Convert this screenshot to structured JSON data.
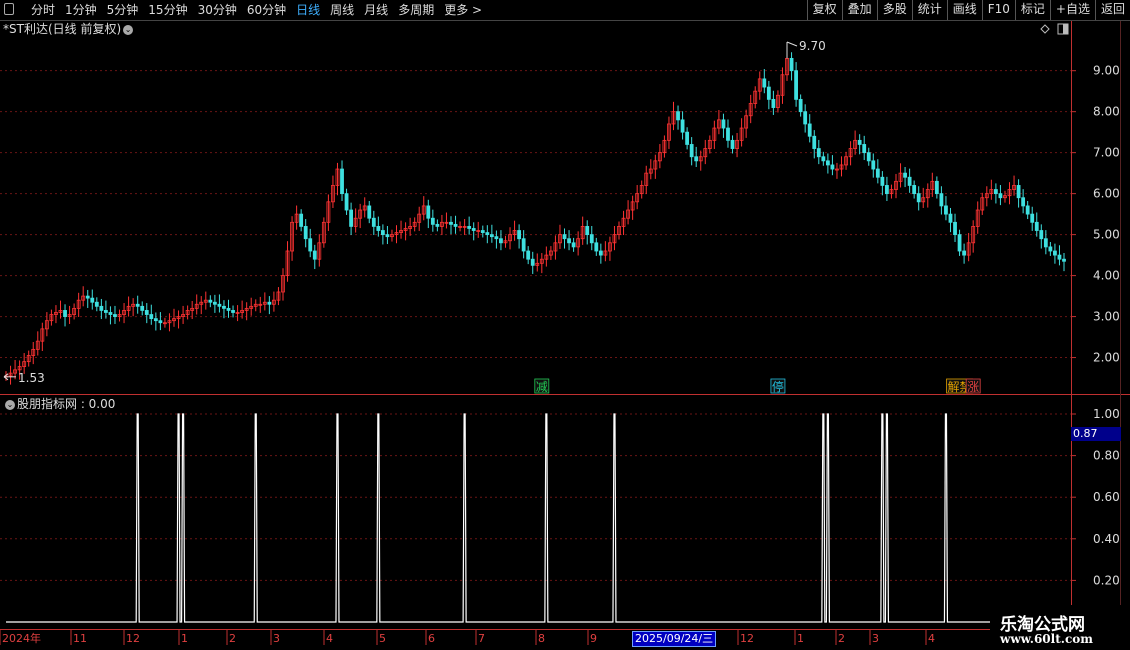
{
  "toolbar": {
    "period_tabs": [
      "分时",
      "1分钟",
      "5分钟",
      "15分钟",
      "30分钟",
      "60分钟",
      "日线",
      "周线",
      "月线",
      "多周期",
      "更多 >"
    ],
    "active_tab": "日线",
    "right_buttons": [
      "复权",
      "叠加",
      "多股",
      "统计",
      "画线",
      "F10",
      "标记",
      "+自选",
      "返回"
    ]
  },
  "main_chart": {
    "title": "*ST利达(日线 前复权)",
    "high_label": "9.70",
    "low_label": "1.53",
    "price_axis": [
      "9.00",
      "8.00",
      "7.00",
      "6.00",
      "5.00",
      "4.00",
      "3.00",
      "2.00"
    ],
    "price_range": [
      1.55,
      9.7
    ],
    "markers": [
      {
        "text": "减",
        "color": "#22cc55",
        "day": 118
      },
      {
        "text": "停",
        "color": "#22c0e0",
        "day": 170
      },
      {
        "text": "解禁",
        "color": "#e0a000",
        "day": 210
      },
      {
        "text": "涨",
        "color": "#e04040",
        "day": 213
      }
    ]
  },
  "indicator": {
    "title": "股朋指标网 : 0.00",
    "axis": [
      "1.00",
      "0.80",
      "0.60",
      "0.40",
      "0.20"
    ],
    "current_value": "0.87",
    "spike_days": [
      29,
      38,
      39,
      55,
      73,
      82,
      101,
      119,
      134,
      180,
      181,
      193,
      194,
      207
    ]
  },
  "date_axis": {
    "labels": [
      "2024年",
      "11",
      "12",
      "1",
      "2",
      "3",
      "4",
      "5",
      "6",
      "7",
      "8",
      "9",
      "12",
      "1",
      "2",
      "3",
      "4"
    ],
    "cursor_label": "2025/09/24/三"
  },
  "watermark": {
    "line1": "乐淘公式网",
    "line2": "www.60lt.com"
  },
  "chart_data": {
    "type": "line",
    "title": "*ST利达(日线 前复权)",
    "series": [
      {
        "values": [
          1.55,
          1.62,
          1.7,
          1.78,
          1.9,
          2.05,
          2.2,
          2.4,
          2.7,
          2.9,
          3.05,
          3.1,
          3.15,
          3.0,
          3.05,
          3.2,
          3.4,
          3.5,
          3.45,
          3.35,
          3.25,
          3.15,
          3.1,
          3.05,
          3.0,
          3.05,
          3.15,
          3.25,
          3.3,
          3.25,
          3.15,
          3.05,
          2.95,
          2.9,
          2.85,
          2.85,
          2.9,
          2.95,
          3.0,
          3.05,
          3.15,
          3.2,
          3.3,
          3.35,
          3.4,
          3.35,
          3.3,
          3.25,
          3.2,
          3.15,
          3.1,
          3.1,
          3.15,
          3.2,
          3.25,
          3.3,
          3.3,
          3.35,
          3.3,
          3.4,
          3.6,
          4.0,
          4.6,
          5.3,
          5.5,
          5.2,
          4.9,
          4.6,
          4.4,
          4.8,
          5.3,
          5.8,
          6.2,
          6.6,
          6.0,
          5.6,
          5.2,
          5.4,
          5.6,
          5.7,
          5.4,
          5.2,
          5.1,
          5.0,
          4.95,
          5.0,
          5.05,
          5.1,
          5.15,
          5.2,
          5.3,
          5.5,
          5.7,
          5.4,
          5.25,
          5.2,
          5.3,
          5.3,
          5.25,
          5.2,
          5.2,
          5.2,
          5.15,
          5.1,
          5.1,
          5.05,
          5.0,
          4.95,
          4.9,
          4.8,
          4.85,
          5.0,
          5.1,
          4.9,
          4.6,
          4.4,
          4.25,
          4.3,
          4.4,
          4.5,
          4.6,
          4.8,
          5.0,
          4.9,
          4.8,
          4.7,
          4.9,
          5.2,
          5.0,
          4.8,
          4.6,
          4.5,
          4.6,
          4.8,
          5.0,
          5.2,
          5.4,
          5.6,
          5.8,
          6.0,
          6.2,
          6.5,
          6.6,
          6.8,
          7.0,
          7.3,
          7.7,
          8.0,
          7.8,
          7.5,
          7.2,
          6.9,
          6.8,
          6.9,
          7.1,
          7.3,
          7.6,
          7.8,
          7.6,
          7.3,
          7.1,
          7.3,
          7.6,
          7.9,
          8.2,
          8.5,
          8.8,
          8.6,
          8.3,
          8.1,
          8.4,
          8.9,
          9.3,
          9.0,
          8.3,
          8.0,
          7.7,
          7.4,
          7.1,
          6.9,
          6.8,
          6.7,
          6.6,
          6.6,
          6.7,
          6.9,
          7.1,
          7.3,
          7.2,
          7.0,
          6.8,
          6.6,
          6.4,
          6.2,
          6.0,
          6.1,
          6.3,
          6.5,
          6.4,
          6.2,
          6.0,
          5.8,
          5.9,
          6.1,
          6.3,
          6.0,
          5.7,
          5.5,
          5.3,
          5.0,
          4.6,
          4.5,
          4.8,
          5.2,
          5.6,
          5.9,
          6.0,
          6.1,
          6.0,
          5.9,
          5.95,
          6.1,
          6.2,
          5.9,
          5.7,
          5.5,
          5.3,
          5.1,
          4.9,
          4.7,
          4.6,
          4.5,
          4.4,
          4.35
        ]
      }
    ]
  }
}
